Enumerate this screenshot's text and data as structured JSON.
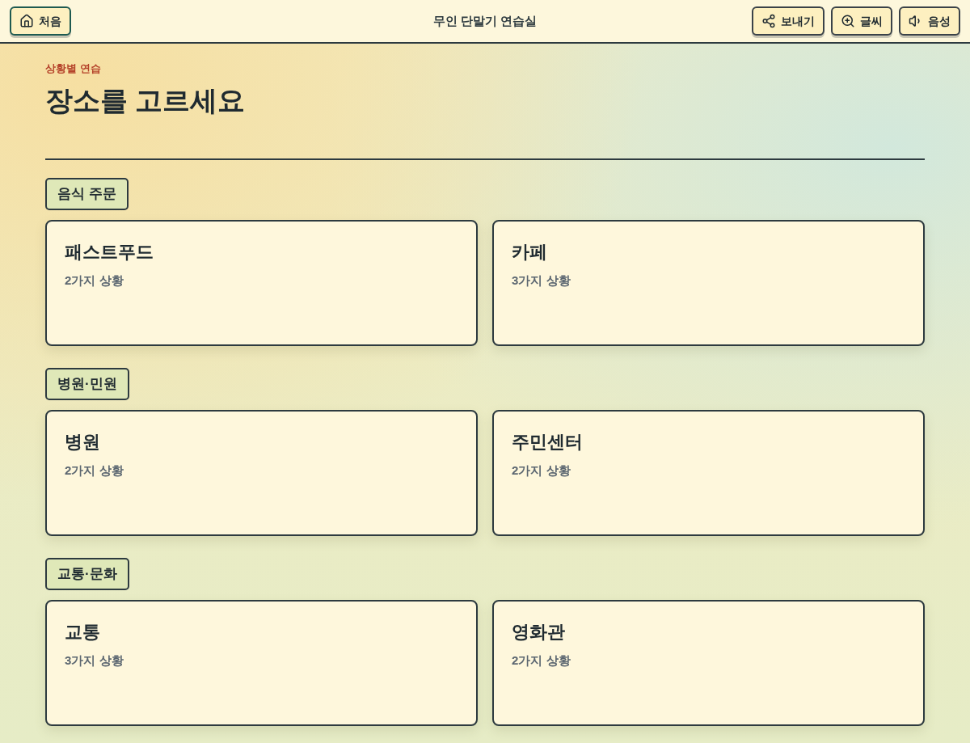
{
  "header": {
    "home_button": {
      "label": "처음"
    },
    "title": "무인 단말기 연습실",
    "actions": [
      {
        "label": "보내기",
        "kind": "share"
      },
      {
        "label": "글씨",
        "kind": "zoom"
      },
      {
        "label": "음성",
        "kind": "voice"
      }
    ]
  },
  "page": {
    "eyebrow": "상황별 연습",
    "heading": "장소를 고르세요"
  },
  "sections": [
    {
      "tag": "음식 주문",
      "places": [
        {
          "name": "패스트푸드",
          "count": "2가지 상황"
        },
        {
          "name": "카페",
          "count": "3가지 상황"
        }
      ]
    },
    {
      "tag": "병원·민원",
      "places": [
        {
          "name": "병원",
          "count": "2가지 상황"
        },
        {
          "name": "주민센터",
          "count": "2가지 상황"
        }
      ]
    },
    {
      "tag": "교통·문화",
      "places": [
        {
          "name": "교통",
          "count": "3가지 상황"
        },
        {
          "name": "영화관",
          "count": "2가지 상황"
        }
      ]
    }
  ]
}
